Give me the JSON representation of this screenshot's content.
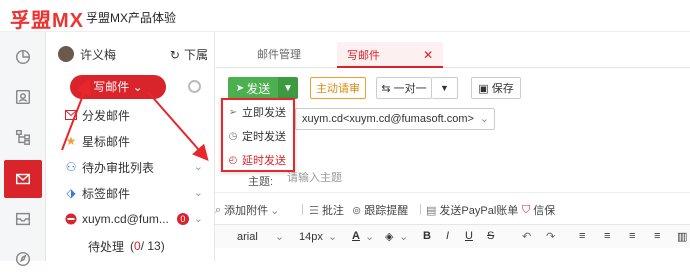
{
  "app": {
    "logo": "孚盟MX",
    "name": "孚盟MX产品体验"
  },
  "rail": {
    "items": [
      {
        "icon": "pie-chart-icon"
      },
      {
        "icon": "contact-card-icon"
      },
      {
        "icon": "org-chart-icon"
      },
      {
        "icon": "mail-icon",
        "active": true
      },
      {
        "icon": "inbox-icon"
      },
      {
        "icon": "compass-icon"
      }
    ]
  },
  "sidebar": {
    "user_name": "许义梅",
    "receive_label": "下属",
    "compose_label": "写邮件",
    "folders": [
      {
        "label": "分发邮件",
        "icon": "envelope-icon"
      },
      {
        "label": "星标邮件",
        "icon": "star-icon"
      },
      {
        "label": "待办审批列表",
        "icon": "approval-icon"
      },
      {
        "label": "标签邮件",
        "icon": "tag-icon"
      },
      {
        "label": "xuym.cd@fum...",
        "icon": "account-icon",
        "badge": "0"
      }
    ],
    "subfolder": {
      "label": "待处理",
      "count_red": "0",
      "count_rest": "/ 13"
    }
  },
  "main": {
    "tabs": [
      {
        "label": "邮件管理"
      },
      {
        "label": "写邮件",
        "active": true
      }
    ],
    "toolbar": {
      "send_label": "发送",
      "invite_label": "主动请审",
      "mode_label": "一对一",
      "save_label": "保存"
    },
    "sender_value": "xuym.cd<xuym.cd@fumasoft.com>",
    "subject_label": "主题:",
    "subject_placeholder": "请输入主题",
    "attach_bar": {
      "attach_label": "添加附件",
      "comment_label": "批注",
      "tracking_label": "跟踪提醒",
      "paypal_label": "发送PayPal账单",
      "letter_label": "信保"
    },
    "format_bar": {
      "font_family": "arial",
      "font_size": "14px"
    }
  },
  "send_menu": {
    "items": [
      {
        "label": "立即发送",
        "icon": "paper-plane-icon"
      },
      {
        "label": "定时发送",
        "icon": "clock-icon"
      },
      {
        "label": "延时发送",
        "icon": "timer-icon",
        "highlighted": true
      }
    ]
  },
  "colors": {
    "brand_red": "#d9242b",
    "send_green": "#4caf50",
    "annotation_red": "#e8262c"
  }
}
